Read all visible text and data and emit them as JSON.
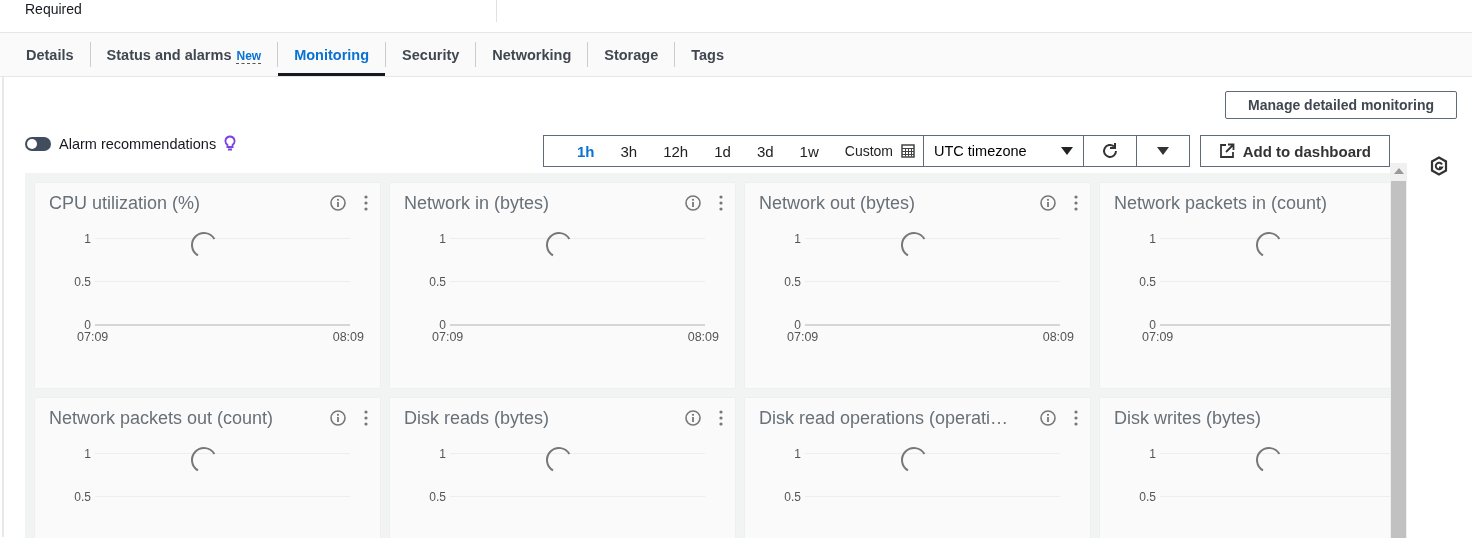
{
  "header": {
    "field_label": "Required"
  },
  "tabs": [
    {
      "label": "Details",
      "selected": false
    },
    {
      "label": "Status and alarms",
      "badge": "New",
      "selected": false
    },
    {
      "label": "Monitoring",
      "selected": true
    },
    {
      "label": "Security",
      "selected": false
    },
    {
      "label": "Networking",
      "selected": false
    },
    {
      "label": "Storage",
      "selected": false
    },
    {
      "label": "Tags",
      "selected": false
    }
  ],
  "manage_button": "Manage detailed monitoring",
  "alarm_toggle": {
    "label": "Alarm recommendations",
    "on": false
  },
  "time_ranges": [
    {
      "label": "1h",
      "selected": true
    },
    {
      "label": "3h",
      "selected": false
    },
    {
      "label": "12h",
      "selected": false
    },
    {
      "label": "1d",
      "selected": false
    },
    {
      "label": "3d",
      "selected": false
    },
    {
      "label": "1w",
      "selected": false
    }
  ],
  "custom_button": "Custom",
  "timezone": "UTC timezone",
  "add_button": "Add to dashboard",
  "widgets": [
    {
      "title": "CPU utilization (%)",
      "yticks": [
        "1",
        "0.5",
        "0"
      ],
      "xticks": [
        "07:09",
        "08:09"
      ]
    },
    {
      "title": "Network in (bytes)",
      "yticks": [
        "1",
        "0.5",
        "0"
      ],
      "xticks": [
        "07:09",
        "08:09"
      ]
    },
    {
      "title": "Network out (bytes)",
      "yticks": [
        "1",
        "0.5",
        "0"
      ],
      "xticks": [
        "07:09",
        "08:09"
      ]
    },
    {
      "title": "Network packets in (count)",
      "yticks": [
        "1",
        "0.5",
        "0"
      ],
      "xticks": [
        "07:09"
      ]
    },
    {
      "title": "Network packets out (count)",
      "yticks": [
        "1",
        "0.5"
      ]
    },
    {
      "title": "Disk reads (bytes)",
      "yticks": [
        "1",
        "0.5"
      ]
    },
    {
      "title": "Disk read operations (operati…",
      "yticks": [
        "1",
        "0.5"
      ]
    },
    {
      "title": "Disk writes (bytes)",
      "yticks": [
        "1",
        "0.5"
      ]
    }
  ]
}
